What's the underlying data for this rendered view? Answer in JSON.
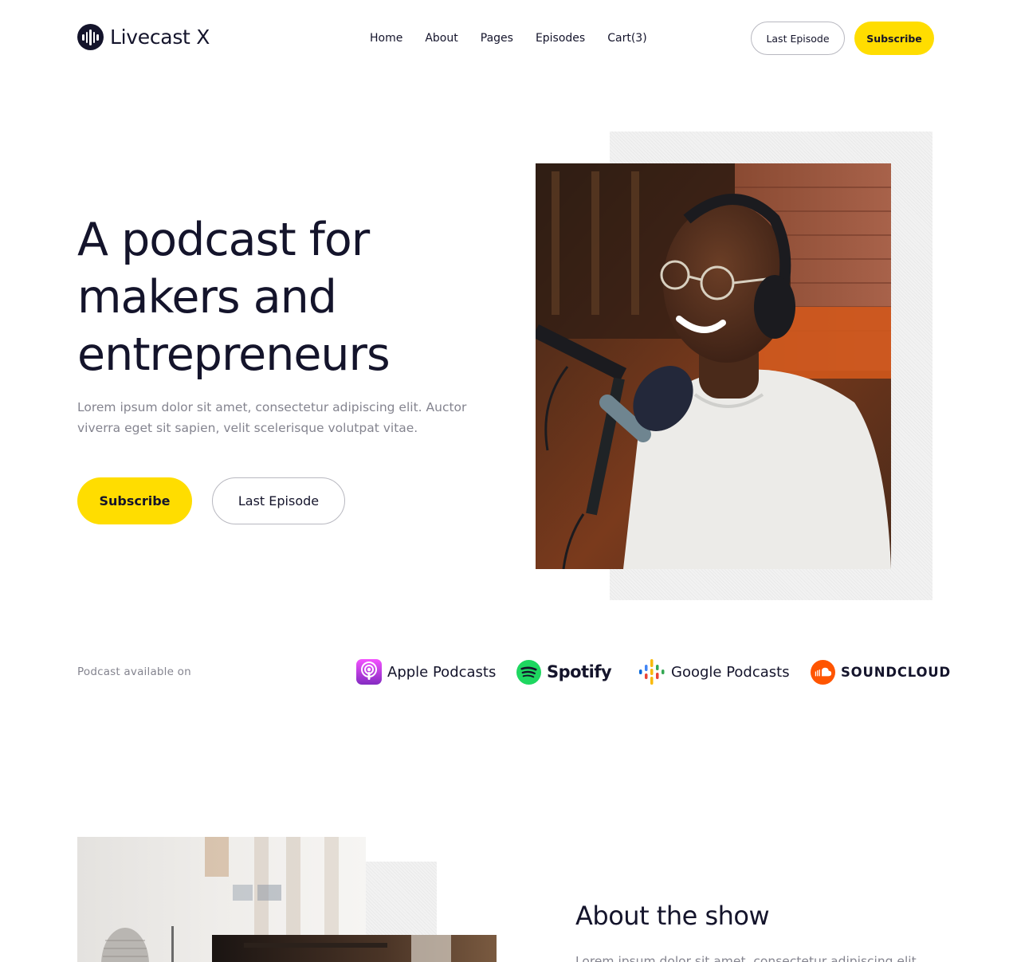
{
  "brand": {
    "name": "Livecast X"
  },
  "nav": {
    "items": [
      "Home",
      "About",
      "Pages",
      "Episodes",
      "Cart(3)"
    ]
  },
  "header": {
    "last_episode_label": "Last Episode",
    "subscribe_label": "Subscribe"
  },
  "hero": {
    "title": "A podcast for makers and entrepreneurs",
    "text": "Lorem ipsum dolor sit amet, consectetur adipiscing elit. Auctor viverra eget sit sapien, velit scelerisque volutpat vitae.",
    "subscribe_label": "Subscribe",
    "last_episode_label": "Last Episode"
  },
  "platforms": {
    "label": "Podcast available on",
    "apple": "Apple Podcasts",
    "spotify": "Spotify",
    "google": "Google Podcasts",
    "soundcloud": "SOUNDCLOUD"
  },
  "about": {
    "title": "About the show",
    "text": "Lorem ipsum dolor sit amet, consectetur adipiscing elit."
  },
  "colors": {
    "accent": "#ffdd00",
    "ink": "#14142b",
    "muted": "#84848f"
  }
}
